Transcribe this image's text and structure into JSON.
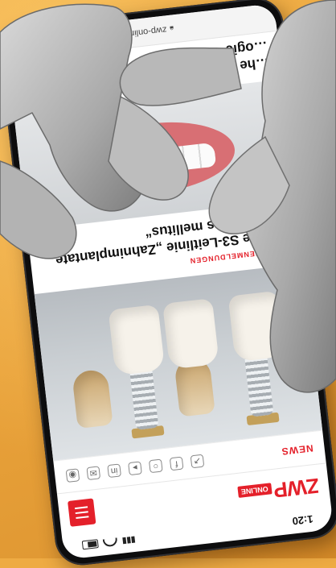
{
  "status_bar": {
    "time": "1:20"
  },
  "header": {
    "logo_main": "ZWP",
    "logo_tag": "ONLINE",
    "menu_icon": "hamburger-menu-icon"
  },
  "section": {
    "label": "NEWS",
    "icons": [
      "social-icon",
      "facebook-icon",
      "instagram-icon",
      "youtube-icon",
      "linkedin-icon",
      "newsletter-icon",
      "podcast-icon"
    ]
  },
  "article": {
    "category": "BRANCHENMELDUNGEN",
    "title": "Update S3-Leitlinie „Zahnimplantate bei Diabetes mellitus“"
  },
  "second_article": {
    "title_line1": "…he Schnittstelle Aligne…",
    "title_line2": "…ogie"
  },
  "browser": {
    "url": "zwp-online.info"
  },
  "colors": {
    "brand_red": "#e4202a",
    "background_orange": "#eeab43"
  }
}
